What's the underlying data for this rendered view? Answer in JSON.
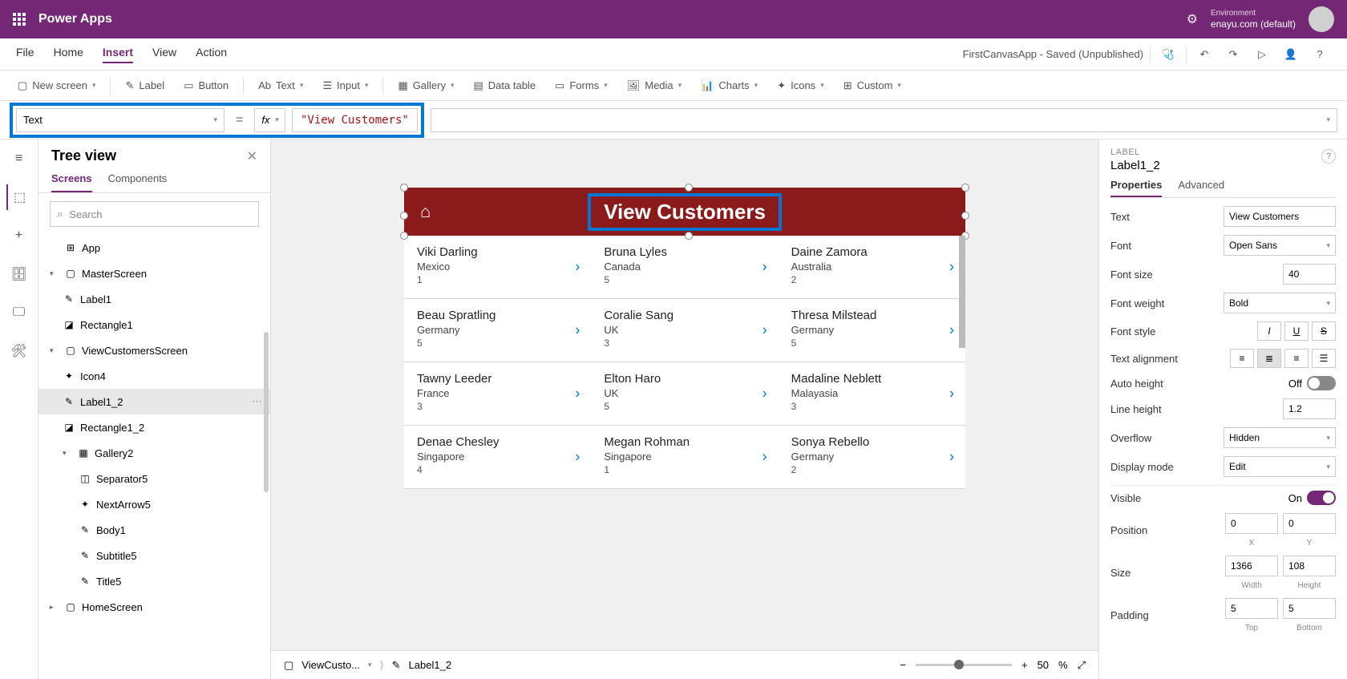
{
  "topbar": {
    "app": "Power Apps",
    "env_label": "Environment",
    "env_value": "enayu.com (default)"
  },
  "menu": {
    "items": [
      "File",
      "Home",
      "Insert",
      "View",
      "Action"
    ],
    "active": "Insert",
    "status": "FirstCanvasApp - Saved (Unpublished)"
  },
  "ribbon": {
    "new_screen": "New screen",
    "label": "Label",
    "button": "Button",
    "text": "Text",
    "input": "Input",
    "gallery": "Gallery",
    "data_table": "Data table",
    "forms": "Forms",
    "media": "Media",
    "charts": "Charts",
    "icons": "Icons",
    "custom": "Custom"
  },
  "formula": {
    "property": "Text",
    "value": "\"View Customers\""
  },
  "tree": {
    "title": "Tree view",
    "tabs": {
      "screens": "Screens",
      "components": "Components"
    },
    "search_placeholder": "Search",
    "nodes": {
      "app": "App",
      "master": "MasterScreen",
      "label1": "Label1",
      "rect1": "Rectangle1",
      "viewcust": "ViewCustomersScreen",
      "icon4": "Icon4",
      "label12": "Label1_2",
      "rect12": "Rectangle1_2",
      "gallery2": "Gallery2",
      "sep5": "Separator5",
      "next5": "NextArrow5",
      "body1": "Body1",
      "subtitle5": "Subtitle5",
      "title5": "Title5",
      "home": "HomeScreen"
    }
  },
  "canvas": {
    "header_text": "View Customers",
    "rows": [
      [
        {
          "name": "Viki Darling",
          "country": "Mexico",
          "num": "1"
        },
        {
          "name": "Bruna Lyles",
          "country": "Canada",
          "num": "5"
        },
        {
          "name": "Daine Zamora",
          "country": "Australia",
          "num": "2"
        }
      ],
      [
        {
          "name": "Beau Spratling",
          "country": "Germany",
          "num": "5"
        },
        {
          "name": "Coralie Sang",
          "country": "UK",
          "num": "3"
        },
        {
          "name": "Thresa Milstead",
          "country": "Germany",
          "num": "5"
        }
      ],
      [
        {
          "name": "Tawny Leeder",
          "country": "France",
          "num": "3"
        },
        {
          "name": "Elton Haro",
          "country": "UK",
          "num": "5"
        },
        {
          "name": "Madaline Neblett",
          "country": "Malayasia",
          "num": "3"
        }
      ],
      [
        {
          "name": "Denae Chesley",
          "country": "Singapore",
          "num": "4"
        },
        {
          "name": "Megan Rohman",
          "country": "Singapore",
          "num": "1"
        },
        {
          "name": "Sonya Rebello",
          "country": "Germany",
          "num": "2"
        }
      ]
    ]
  },
  "breadcrumb": {
    "screen": "ViewCusto...",
    "element": "Label1_2",
    "zoom": "50",
    "pct": "%"
  },
  "props": {
    "type": "LABEL",
    "name": "Label1_2",
    "tabs": {
      "properties": "Properties",
      "advanced": "Advanced"
    },
    "text_l": "Text",
    "text_v": "View Customers",
    "font_l": "Font",
    "font_v": "Open Sans",
    "fontsize_l": "Font size",
    "fontsize_v": "40",
    "fontweight_l": "Font weight",
    "fontweight_v": "Bold",
    "fontstyle_l": "Font style",
    "align_l": "Text alignment",
    "autoheight_l": "Auto height",
    "autoheight_v": "Off",
    "lineheight_l": "Line height",
    "lineheight_v": "1.2",
    "overflow_l": "Overflow",
    "overflow_v": "Hidden",
    "display_l": "Display mode",
    "display_v": "Edit",
    "visible_l": "Visible",
    "visible_v": "On",
    "position_l": "Position",
    "pos_x": "0",
    "pos_y": "0",
    "x_l": "X",
    "y_l": "Y",
    "size_l": "Size",
    "size_w": "1366",
    "size_h": "108",
    "w_l": "Width",
    "h_l": "Height",
    "padding_l": "Padding",
    "pad_t": "5",
    "pad_b": "5",
    "t_l": "Top",
    "b_l": "Bottom"
  }
}
